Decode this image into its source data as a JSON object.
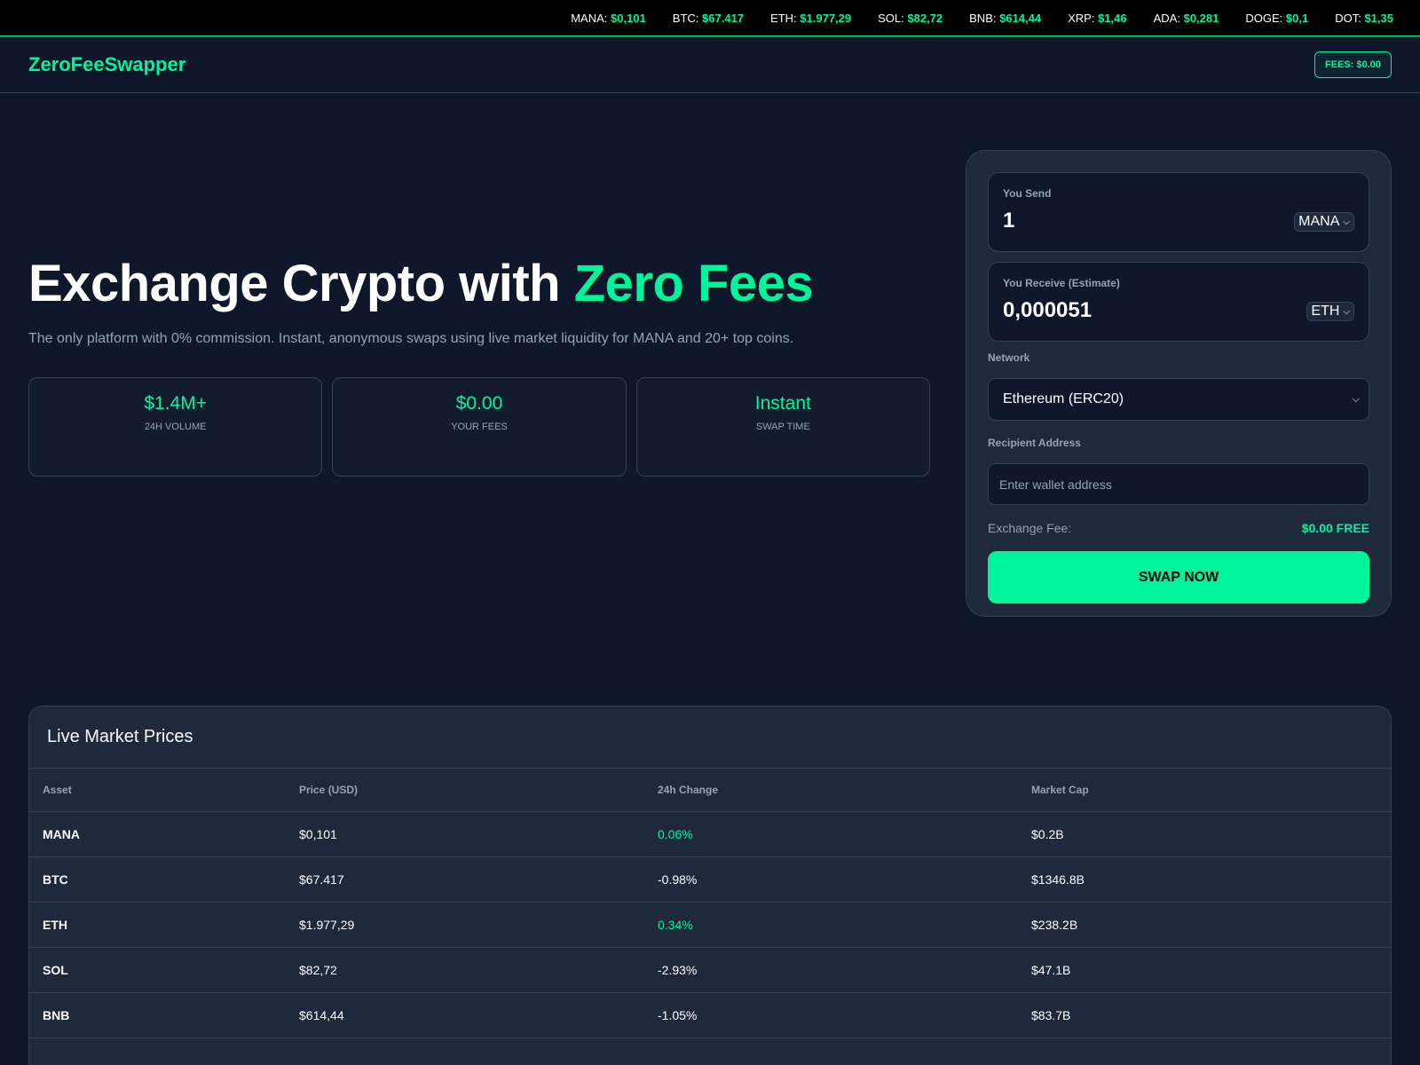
{
  "ticker": [
    {
      "symbol": "MANA:",
      "price": "$0,101"
    },
    {
      "symbol": "BTC:",
      "price": "$67.417"
    },
    {
      "symbol": "ETH:",
      "price": "$1.977,29"
    },
    {
      "symbol": "SOL:",
      "price": "$82,72"
    },
    {
      "symbol": "BNB:",
      "price": "$614,44"
    },
    {
      "symbol": "XRP:",
      "price": "$1,46"
    },
    {
      "symbol": "ADA:",
      "price": "$0,281"
    },
    {
      "symbol": "DOGE:",
      "price": "$0,1"
    },
    {
      "symbol": "DOT:",
      "price": "$1,35"
    }
  ],
  "header": {
    "logo": "ZeroFeeSwapper",
    "fees_badge": "FEES: $0.00"
  },
  "hero": {
    "title_main": "Exchange Crypto with ",
    "title_accent": "Zero Fees",
    "subtitle": "The only platform with 0% commission. Instant, anonymous swaps using live market liquidity for MANA and 20+ top coins.",
    "stats": [
      {
        "value": "$1.4M+",
        "label": "24H Volume"
      },
      {
        "value": "$0.00",
        "label": "Your Fees"
      },
      {
        "value": "Instant",
        "label": "Swap Time"
      }
    ]
  },
  "swap": {
    "send_label": "You Send",
    "send_value": "1",
    "send_currency": "MANA",
    "receive_label": "You Receive (Estimate)",
    "receive_value": "0,000051",
    "receive_currency": "ETH",
    "network_label": "Network",
    "network_value": "Ethereum (ERC20)",
    "address_label": "Recipient Address",
    "address_placeholder": "Enter wallet address",
    "fee_label": "Exchange Fee:",
    "fee_value": "$0.00 FREE",
    "button_label": "Swap Now"
  },
  "market": {
    "title": "Live Market Prices",
    "columns": [
      "Asset",
      "Price (USD)",
      "24h Change",
      "Market Cap"
    ],
    "rows": [
      {
        "asset": "MANA",
        "price": "$0,101",
        "change": "0.06%",
        "cap": "$0.2B",
        "positive": true
      },
      {
        "asset": "BTC",
        "price": "$67.417",
        "change": "-0.98%",
        "cap": "$1346.8B",
        "positive": false
      },
      {
        "asset": "ETH",
        "price": "$1.977,29",
        "change": "0.34%",
        "cap": "$238.2B",
        "positive": true
      },
      {
        "asset": "SOL",
        "price": "$82,72",
        "change": "-2.93%",
        "cap": "$47.1B",
        "positive": false
      },
      {
        "asset": "BNB",
        "price": "$614,44",
        "change": "-1.05%",
        "cap": "$83.7B",
        "positive": false
      }
    ]
  },
  "colors": {
    "accent": "#00f59b",
    "background": "#0f172a",
    "card": "#1e293b",
    "muted": "#94a3b8"
  }
}
